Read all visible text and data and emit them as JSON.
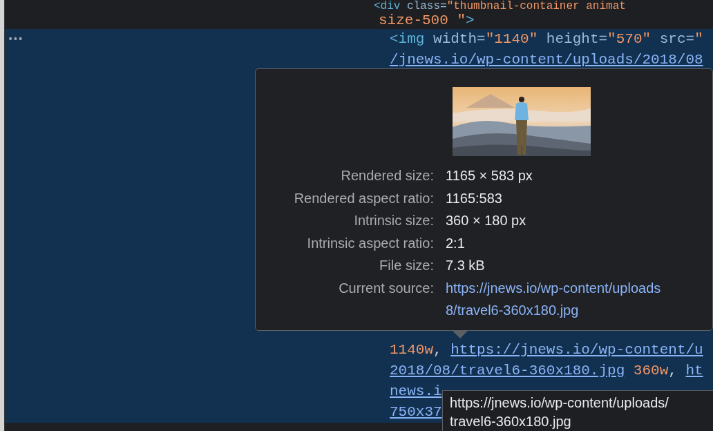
{
  "code_header": [
    {
      "segments": [
        {
          "kind": "tag",
          "text": "<div"
        },
        {
          "kind": "attr",
          "text": " class="
        },
        {
          "kind": "value",
          "text": "\"thumbnail-container animat"
        }
      ]
    },
    {
      "segments": [
        {
          "kind": "value",
          "text": "size-500 \""
        },
        {
          "kind": "tag",
          "text": ">"
        }
      ]
    }
  ],
  "selected_node": {
    "gutter": "•••",
    "selected": true,
    "lines_top": [
      {
        "segments": [
          {
            "kind": "tag",
            "text": "<img"
          },
          {
            "kind": "attr",
            "text": " width="
          },
          {
            "kind": "value",
            "text": "\"1140\""
          },
          {
            "kind": "attr",
            "text": " height="
          },
          {
            "kind": "value",
            "text": "\"570\""
          },
          {
            "kind": "attr",
            "text": " src="
          },
          {
            "kind": "value",
            "text": "\""
          }
        ]
      },
      {
        "segments": [
          {
            "kind": "link",
            "text": "/jnews.io/wp-content/uploads/2018/08"
          }
        ]
      }
    ],
    "lines_bottom": [
      {
        "segments": [
          {
            "kind": "value",
            "text": "1140w"
          },
          {
            "kind": "punct",
            "text": ", "
          },
          {
            "kind": "link",
            "text": "https://jnews.io/wp-content/u"
          }
        ]
      },
      {
        "segments": [
          {
            "kind": "link",
            "text": "2018/08/travel6-360x180.jpg"
          },
          {
            "kind": "value",
            "text": " 360w"
          },
          {
            "kind": "punct",
            "text": ", "
          },
          {
            "kind": "link",
            "text": "ht"
          }
        ]
      },
      {
        "segments": [
          {
            "kind": "link",
            "text": "news.i"
          }
        ]
      },
      {
        "segments": [
          {
            "kind": "link",
            "text": "750x37"
          }
        ]
      }
    ]
  },
  "image_popover": {
    "rows": [
      {
        "label": "Rendered size:",
        "value": [
          "1165 × 583 px"
        ],
        "kind": "text"
      },
      {
        "label": "Rendered aspect ratio:",
        "value": [
          "1165:583"
        ],
        "kind": "text"
      },
      {
        "label": "Intrinsic size:",
        "value": [
          "360 × 180 px"
        ],
        "kind": "text"
      },
      {
        "label": "Intrinsic aspect ratio:",
        "value": [
          "2:1"
        ],
        "kind": "text"
      },
      {
        "label": "File size:",
        "value": [
          "7.3 kB"
        ],
        "kind": "text"
      },
      {
        "label": "Current source:",
        "value": [
          "https://jnews.io/wp-content/uploads",
          "8/travel6-360x180.jpg"
        ],
        "kind": "link"
      }
    ]
  },
  "url_tooltip": [
    "https://jnews.io/wp-content/uploads/",
    "travel6-360x180.jpg"
  ]
}
